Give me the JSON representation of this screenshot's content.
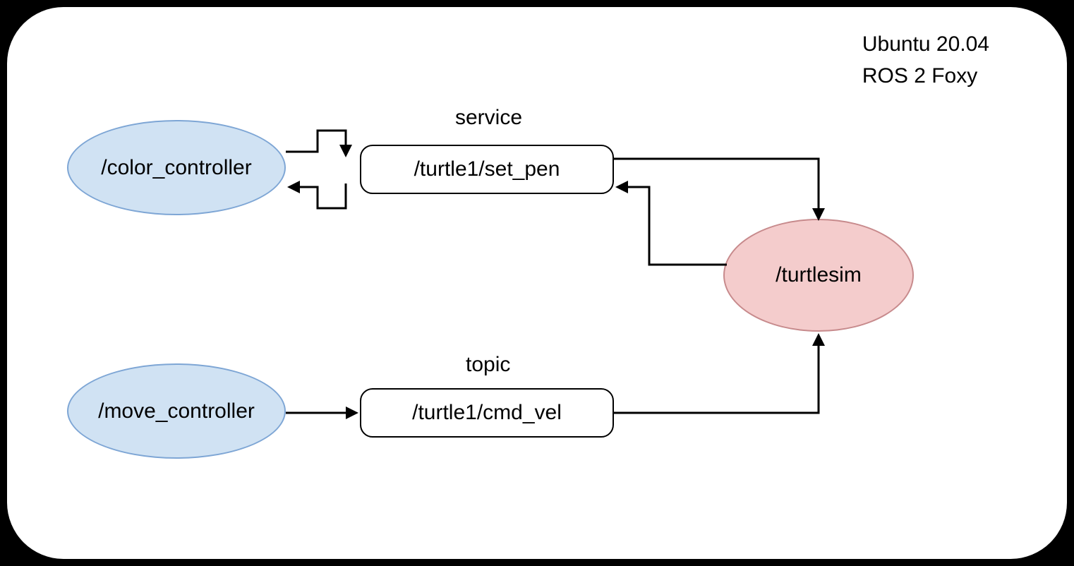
{
  "header": {
    "line1": "Ubuntu 20.04",
    "line2": "ROS 2 Foxy"
  },
  "nodes": {
    "color_controller": "/color_controller",
    "move_controller": "/move_controller",
    "turtlesim": "/turtlesim"
  },
  "channels": {
    "set_pen": "/turtle1/set_pen",
    "cmd_vel": "/turtle1/cmd_vel"
  },
  "labels": {
    "service": "service",
    "topic": "topic"
  }
}
